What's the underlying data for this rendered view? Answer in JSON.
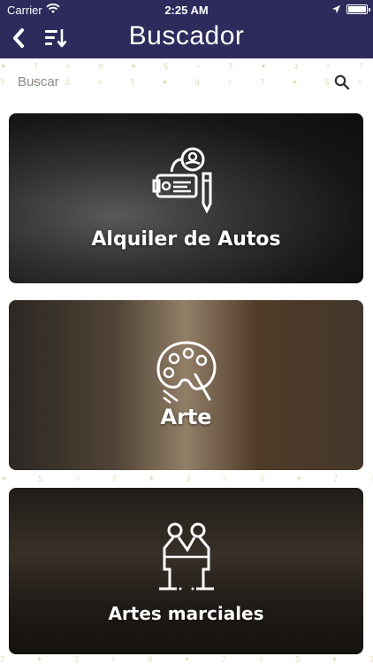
{
  "status_bar": {
    "carrier": "Carrier",
    "time": "2:25 AM"
  },
  "nav": {
    "title": "Buscador",
    "back_icon": "chevron-left-icon",
    "sort_icon": "sort-icon"
  },
  "search": {
    "placeholder": "Buscar",
    "value": "",
    "icon": "search-icon"
  },
  "categories": [
    {
      "label": "Alquiler de Autos",
      "icon": "car-rental-icon"
    },
    {
      "label": "Arte",
      "icon": "art-palette-icon"
    },
    {
      "label": "Artes marciales",
      "icon": "martial-arts-icon"
    }
  ],
  "colors": {
    "header": "#2d2b5c",
    "text_light": "#ffffff",
    "pattern_accent": "#c9a050"
  }
}
